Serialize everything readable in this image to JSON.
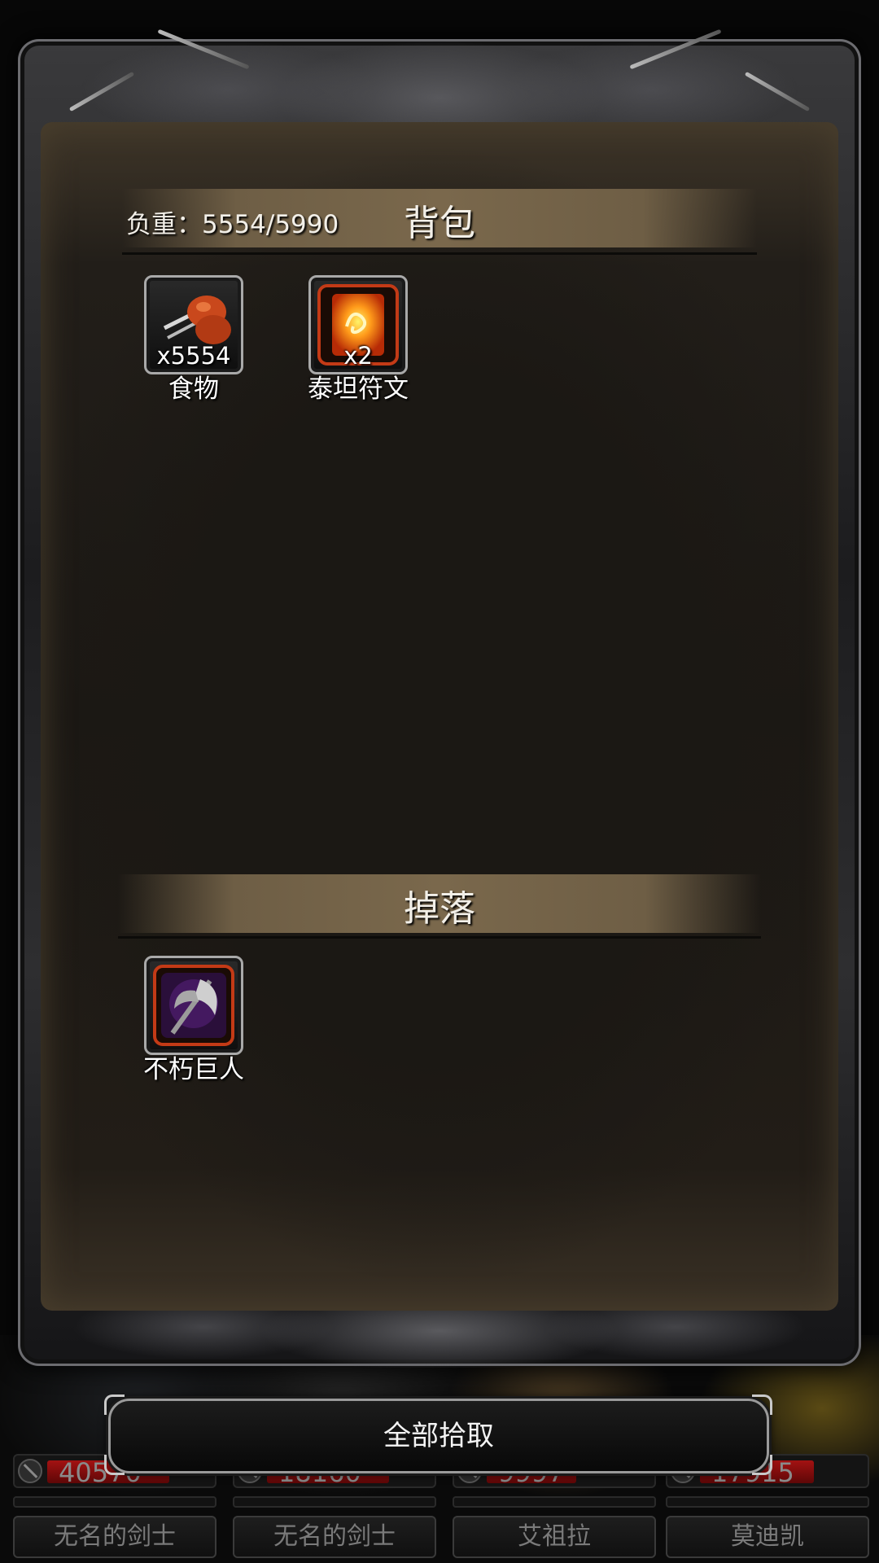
{
  "inventory": {
    "title": "背包",
    "weight_label": "负重：5554/5990",
    "items": [
      {
        "name": "食物",
        "quantity": "x5554",
        "icon": "roast-meat-icon"
      },
      {
        "name": "泰坦符文",
        "quantity": "x2",
        "icon": "fire-rune-icon"
      }
    ]
  },
  "drops": {
    "title": "掉落",
    "items": [
      {
        "name": "不朽巨人",
        "quantity": "",
        "icon": "purple-axe-icon"
      }
    ]
  },
  "pickup_all_label": "全部拾取",
  "party": [
    {
      "name": "无名的剑士",
      "hp": "40570",
      "hp_fraction": 0.75
    },
    {
      "name": "无名的剑士",
      "hp": "18160",
      "hp_fraction": 0.75
    },
    {
      "name": "艾祖拉",
      "hp": "9997",
      "hp_fraction": 0.55
    },
    {
      "name": "莫迪凯",
      "hp": "17915",
      "hp_fraction": 0.7
    }
  ],
  "colors": {
    "rare_border": "#c33a16",
    "hp_red": "#a31212"
  }
}
